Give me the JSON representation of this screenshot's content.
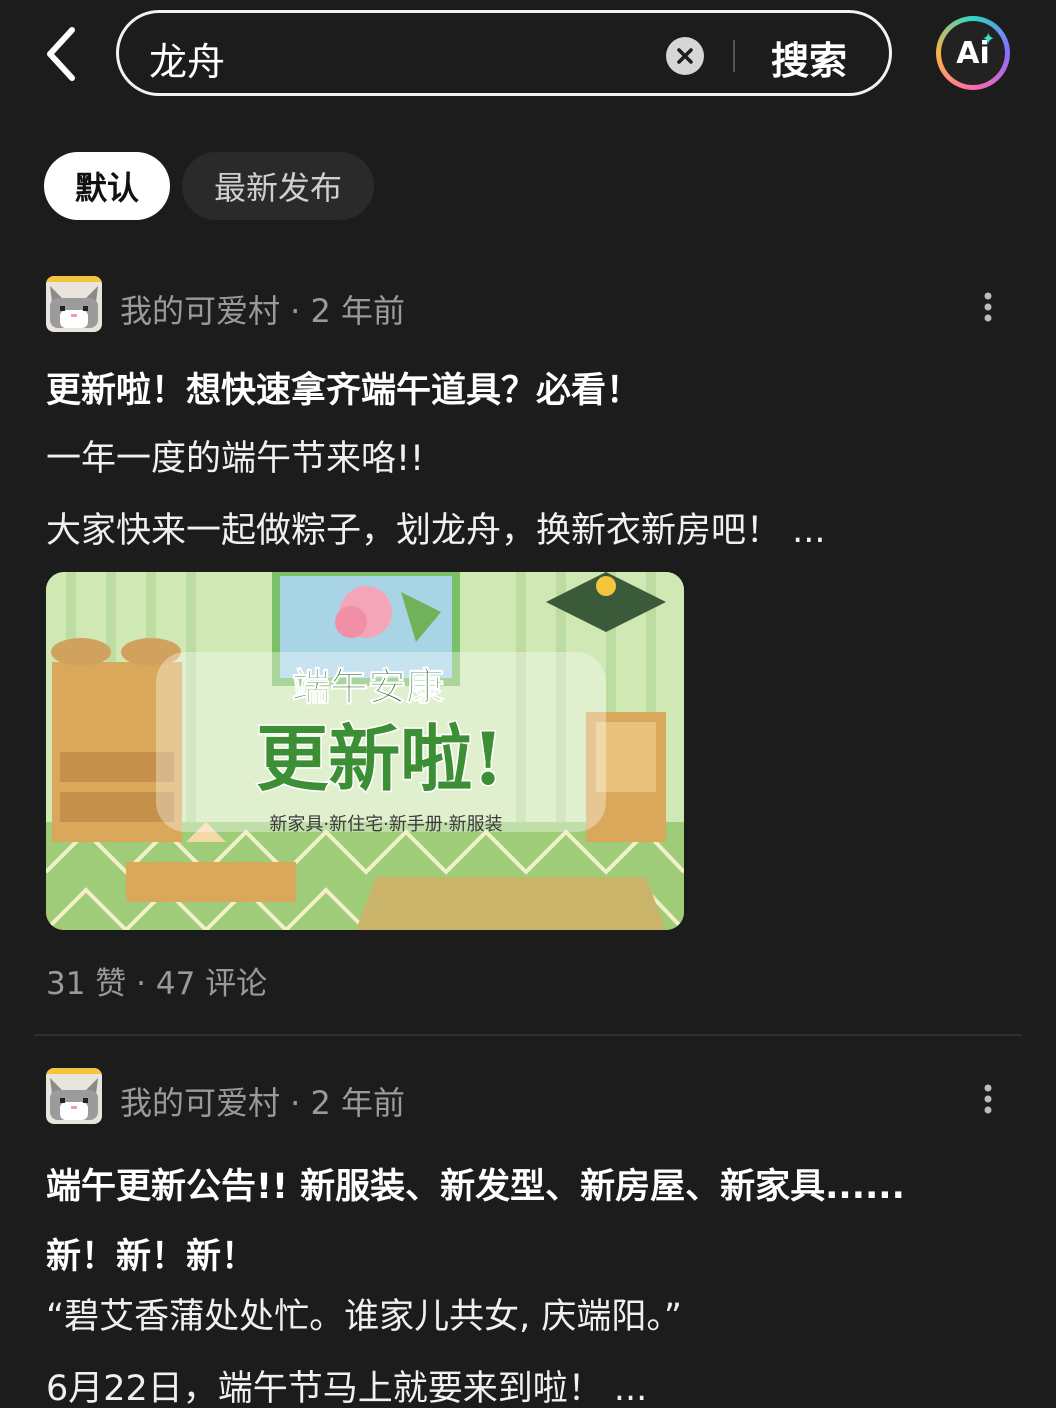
{
  "search": {
    "query": "龙舟",
    "button_label": "搜索",
    "ai_label": "Ai"
  },
  "tabs": [
    {
      "label": "默认",
      "active": true
    },
    {
      "label": "最新发布",
      "active": false
    }
  ],
  "posts": [
    {
      "author_meta": "我的可爱村 · 2 年前",
      "title": "更新啦！想快速拿齐端午道具？必看！",
      "body": [
        "一年一度的端午节来咯!!",
        "大家快来一起做粽子，划龙舟，换新衣新房吧！ ..."
      ],
      "image": {
        "headline_small": "端午安康",
        "headline_big": "更新啦!",
        "caption": "新家具·新住宅·新手册·新服装"
      },
      "stats": "31 赞 · 47 评论"
    },
    {
      "author_meta": "我的可爱村 · 2 年前",
      "title": "端午更新公告!! 新服装、新发型、新房屋、新家具......",
      "subtitle": "新！新！新！",
      "body": [
        "“碧艾香蒲处处忙。谁家儿共女, 庆端阳。”",
        "6月22日，端午节马上就要来到啦！ ..."
      ]
    }
  ],
  "colors": {
    "background": "#1c1c1c",
    "muted_text": "#9a9a9a",
    "tab_active_bg": "#ffffff",
    "tab_inactive_bg": "#2a2a2a"
  },
  "icons": [
    "back-arrow-icon",
    "clear-icon",
    "ai-icon",
    "more-vertical-icon",
    "avatar-cat-icon"
  ]
}
